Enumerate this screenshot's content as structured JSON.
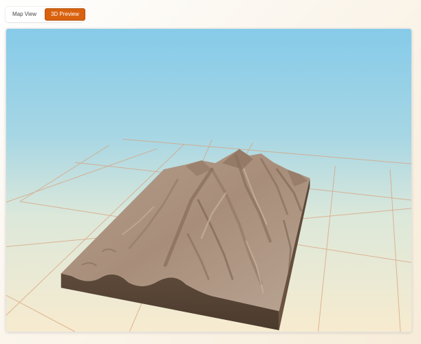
{
  "tabs": [
    {
      "label": "Map View",
      "active": false
    },
    {
      "label": "3D Preview",
      "active": true
    }
  ],
  "colors": {
    "accent": "#d9620f",
    "sky_top": "#87cbe9",
    "sky_bottom": "#f6ecd6",
    "terrain": "#a48b78",
    "terrain_side": "#574536",
    "grid": "#d9a27e"
  },
  "scene": {
    "view": "3D terrain preview"
  }
}
